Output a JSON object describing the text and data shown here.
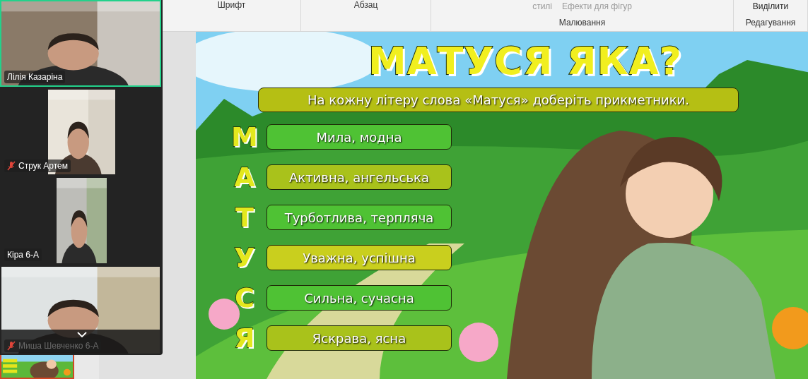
{
  "video_call": {
    "participants": [
      {
        "name": "Лілія Казаріна",
        "speaking": true,
        "muted": false
      },
      {
        "name": "Струк Артем",
        "speaking": false,
        "muted": true
      },
      {
        "name": "Кіра 6-А",
        "speaking": false,
        "muted": false
      },
      {
        "name": "Миша Шевченко 6-А",
        "speaking": false,
        "muted": true
      }
    ]
  },
  "ribbon": {
    "groups": [
      {
        "label": "Шрифт"
      },
      {
        "label": "Абзац"
      },
      {
        "label": "Малювання",
        "buttons": [
          "стилі",
          "Ефекти для фігур"
        ]
      },
      {
        "label": "Редагування",
        "buttons": [
          "Виділити"
        ]
      }
    ]
  },
  "slides_pane": {
    "thumbnails": [
      {
        "selected": true
      }
    ]
  },
  "slide": {
    "title": "МАТУСЯ ЯКА?",
    "instruction": "На кожну літеру слова «Матуся» доберіть прикметники.",
    "rows": [
      {
        "letter": "М",
        "answer": "Мила, модна",
        "color": "#4fc234"
      },
      {
        "letter": "А",
        "answer": "Активна, ангельська",
        "color": "#a9c21b"
      },
      {
        "letter": "Т",
        "answer": "Турботлива, терпляча",
        "color": "#4fc234"
      },
      {
        "letter": "У",
        "answer": "Уважна, успішна",
        "color": "#c9cf1e"
      },
      {
        "letter": "С",
        "answer": "Сильна, сучасна",
        "color": "#4fc234"
      },
      {
        "letter": "Я",
        "answer": "Яскрава, ясна",
        "color": "#a9c21b"
      }
    ]
  }
}
